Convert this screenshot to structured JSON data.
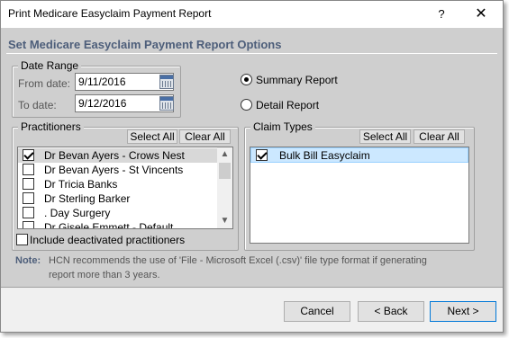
{
  "window": {
    "title": "Print Medicare Easyclaim Payment Report",
    "help_label": "?",
    "close_label": "✕"
  },
  "heading": "Set Medicare Easyclaim Payment Report Options",
  "date_range": {
    "legend": "Date Range",
    "from_label": "From date:",
    "from_value": "9/11/2016",
    "to_label": "To date:",
    "to_value": "9/12/2016"
  },
  "report_type": {
    "options": [
      {
        "label": "Summary Report",
        "selected": true
      },
      {
        "label": "Detail Report",
        "selected": false
      }
    ]
  },
  "practitioners": {
    "legend": "Practitioners",
    "select_all": "Select All",
    "clear_all": "Clear All",
    "items": [
      {
        "label": "Dr Bevan Ayers - Crows Nest",
        "checked": true
      },
      {
        "label": "Dr Bevan Ayers - St Vincents",
        "checked": false
      },
      {
        "label": "Dr Tricia Banks",
        "checked": false
      },
      {
        "label": "Dr Sterling Barker",
        "checked": false
      },
      {
        "label": ". Day Surgery",
        "checked": false
      },
      {
        "label": "Dr Gisele Emmett - Default",
        "checked": false
      }
    ],
    "include_deactivated": "Include deactivated practitioners"
  },
  "claim_types": {
    "legend": "Claim Types",
    "select_all": "Select All",
    "clear_all": "Clear All",
    "items": [
      {
        "label": "Bulk Bill Easyclaim",
        "checked": true
      }
    ]
  },
  "note": {
    "label": "Note:",
    "line1": "HCN recommends the use of 'File - Microsoft Excel (.csv)' file type format if generating",
    "line2": "report more than 3 years."
  },
  "buttons": {
    "cancel": "Cancel",
    "back": "< Back",
    "next": "Next >"
  },
  "icons": [
    "calendar-icon",
    "help-icon",
    "close-icon",
    "chevron-up-icon",
    "chevron-down-icon"
  ]
}
